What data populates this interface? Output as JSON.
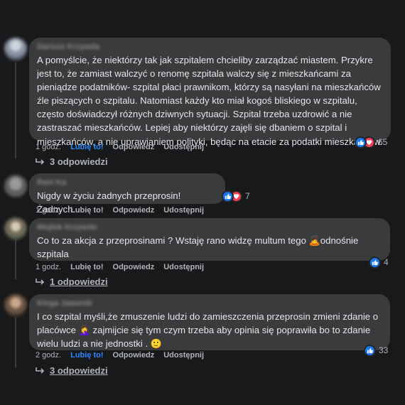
{
  "comments": [
    {
      "author": "Dariusz Krzywda",
      "text": "A pomyślcie, że niektórzy tak jak szpitalem chcieliby zarządzać miastem. Przykre jest to, że zamiast walczyć o renomę szpitala walczy się z mieszkańcami za pieniądze podatników- szpital płaci prawnikom, którzy są nasyłani na mieszkańców źle piszących o szpitalu. Natomiast każdy kto miał kogoś bliskiego w szpitalu, często doświadczył różnych dziwnych sytuacji. Szpital trzeba uzdrowić a nie zastraszać mieszkańców. Lepiej aby niektórzy zajęli się dbaniem o szpital i mieszkańców, a nie uprawianiem polityki, będąc na etacie za podatki mieszkańców.",
      "time": "1 godz.",
      "like_label": "Lubię to!",
      "reply_label": "Odpowiedz",
      "share_label": "Udostępnij",
      "reactions": [
        "like",
        "love"
      ],
      "reaction_count": "65",
      "replies_label": "3 odpowiedzi",
      "liked": true
    },
    {
      "author": "Rani Ka",
      "text": "Nigdy w życiu żadnych przeprosin! Żadnych.",
      "time": "1 godz.",
      "like_label": "Lubię to!",
      "reply_label": "Odpowiedz",
      "share_label": "Udostępnij",
      "reactions": [
        "like",
        "love"
      ],
      "reaction_count": "7",
      "liked": false
    },
    {
      "author": "Wojtek Krzywda",
      "text_before": "Co to za akcja z przeprosinami ? Wstaję rano widzę multum tego",
      "emoji": "🙇",
      "text_after": "odnośnie szpitala",
      "time": "1 godz.",
      "like_label": "Lubię to!",
      "reply_label": "Odpowiedz",
      "share_label": "Udostępnij",
      "reactions": [
        "like"
      ],
      "reaction_count": "4",
      "replies_label": "1 odpowiedzi",
      "liked": false
    },
    {
      "author": "Kinga Jaworek",
      "text_before": "I co szpital myśli,że zmuszenie ludzi do zamieszczenia przeprosin zmieni zdanie o placówce",
      "emoji": "🤦‍♀️",
      "text_after": "zajmijcie się tym czym trzeba aby opinia się poprawiła bo to zdanie wielu ludzi a nie jednostki .",
      "emoji2": "🙂",
      "time": "2 godz.",
      "like_label": "Lubię to!",
      "reply_label": "Odpowiedz",
      "share_label": "Udostępnij",
      "reactions": [
        "like"
      ],
      "reaction_count": "33",
      "replies_label": "3 odpowiedzi",
      "liked": true
    }
  ],
  "colors": {
    "background": "#18191a",
    "bubble": "#3a3b3c",
    "text": "#e4e6eb",
    "muted": "#b0b3b8",
    "liked": "#2d88ff",
    "like_icon": "#1877f2",
    "love_icon": "#f33e58"
  },
  "icons": {
    "like": "thumbs-up-icon",
    "love": "heart-icon",
    "reply_arrow": "reply-arrow-icon"
  }
}
